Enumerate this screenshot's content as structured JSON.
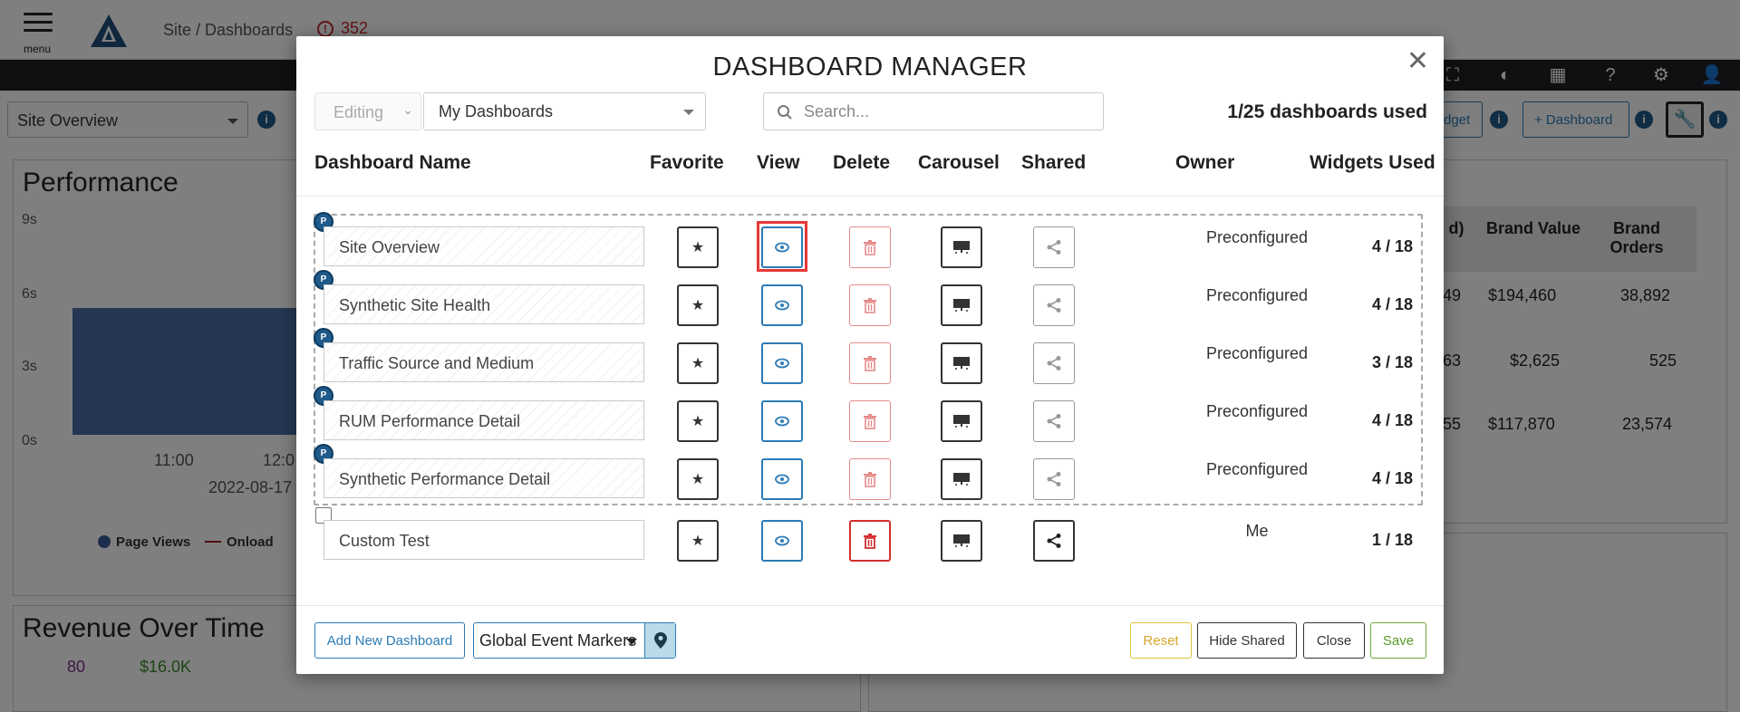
{
  "app": {
    "menu_label": "menu",
    "breadcrumb": "Site / Dashboards",
    "alert_count": "352",
    "site_select": "Site Overview",
    "widget_btn": "dget",
    "add_dashboard_btn": "+ Dashboard",
    "perf_title": "Performance",
    "perf_yticks": [
      "9s",
      "6s",
      "3s",
      "0s"
    ],
    "perf_xticks": [
      "11:00",
      "12:0"
    ],
    "perf_date": "2022-08-17",
    "legend": [
      "Page Views",
      "Onload"
    ],
    "revenue_title": "Revenue Over Time",
    "revenue_v1": "80",
    "revenue_v2": "$16.0K",
    "table_headers": [
      "d)",
      "Brand Value",
      "Brand Orders"
    ],
    "table_rows": [
      [
        "49",
        "$194,460",
        "38,892"
      ],
      [
        "63",
        "$2,625",
        "525"
      ],
      [
        "55",
        "$117,870",
        "23,574"
      ]
    ]
  },
  "modal": {
    "title": "DASHBOARD MANAGER",
    "mode": "Editing",
    "dashboard_filter": "My Dashboards",
    "search_placeholder": "Search...",
    "usage": "1/25 dashboards used",
    "columns": {
      "name": "Dashboard Name",
      "favorite": "Favorite",
      "view": "View",
      "delete": "Delete",
      "carousel": "Carousel",
      "shared": "Shared",
      "owner": "Owner",
      "widgets": "Widgets Used"
    },
    "preconfigured_badge": "P",
    "rows": [
      {
        "name": "Site Overview",
        "owner": "Preconfigured",
        "widgets": "4 / 18"
      },
      {
        "name": "Synthetic Site Health",
        "owner": "Preconfigured",
        "widgets": "4 / 18"
      },
      {
        "name": "Traffic Source and Medium",
        "owner": "Preconfigured",
        "widgets": "3 / 18"
      },
      {
        "name": "RUM Performance Detail",
        "owner": "Preconfigured",
        "widgets": "4 / 18"
      },
      {
        "name": "Synthetic Performance Detail",
        "owner": "Preconfigured",
        "widgets": "4 / 18"
      },
      {
        "name": "Custom Test",
        "owner": "Me",
        "widgets": "1 / 18"
      }
    ],
    "footer": {
      "add_new": "Add New Dashboard",
      "event_markers": "Global Event Markers",
      "reset": "Reset",
      "hide_shared": "Hide Shared",
      "close": "Close",
      "save": "Save"
    }
  },
  "colors": {
    "accent_blue": "#2c7bb6",
    "delete_red": "#d32f2f",
    "highlight_red": "#e53935",
    "save_green": "#5a9a2a",
    "reset_yellow": "#d4a82a"
  }
}
